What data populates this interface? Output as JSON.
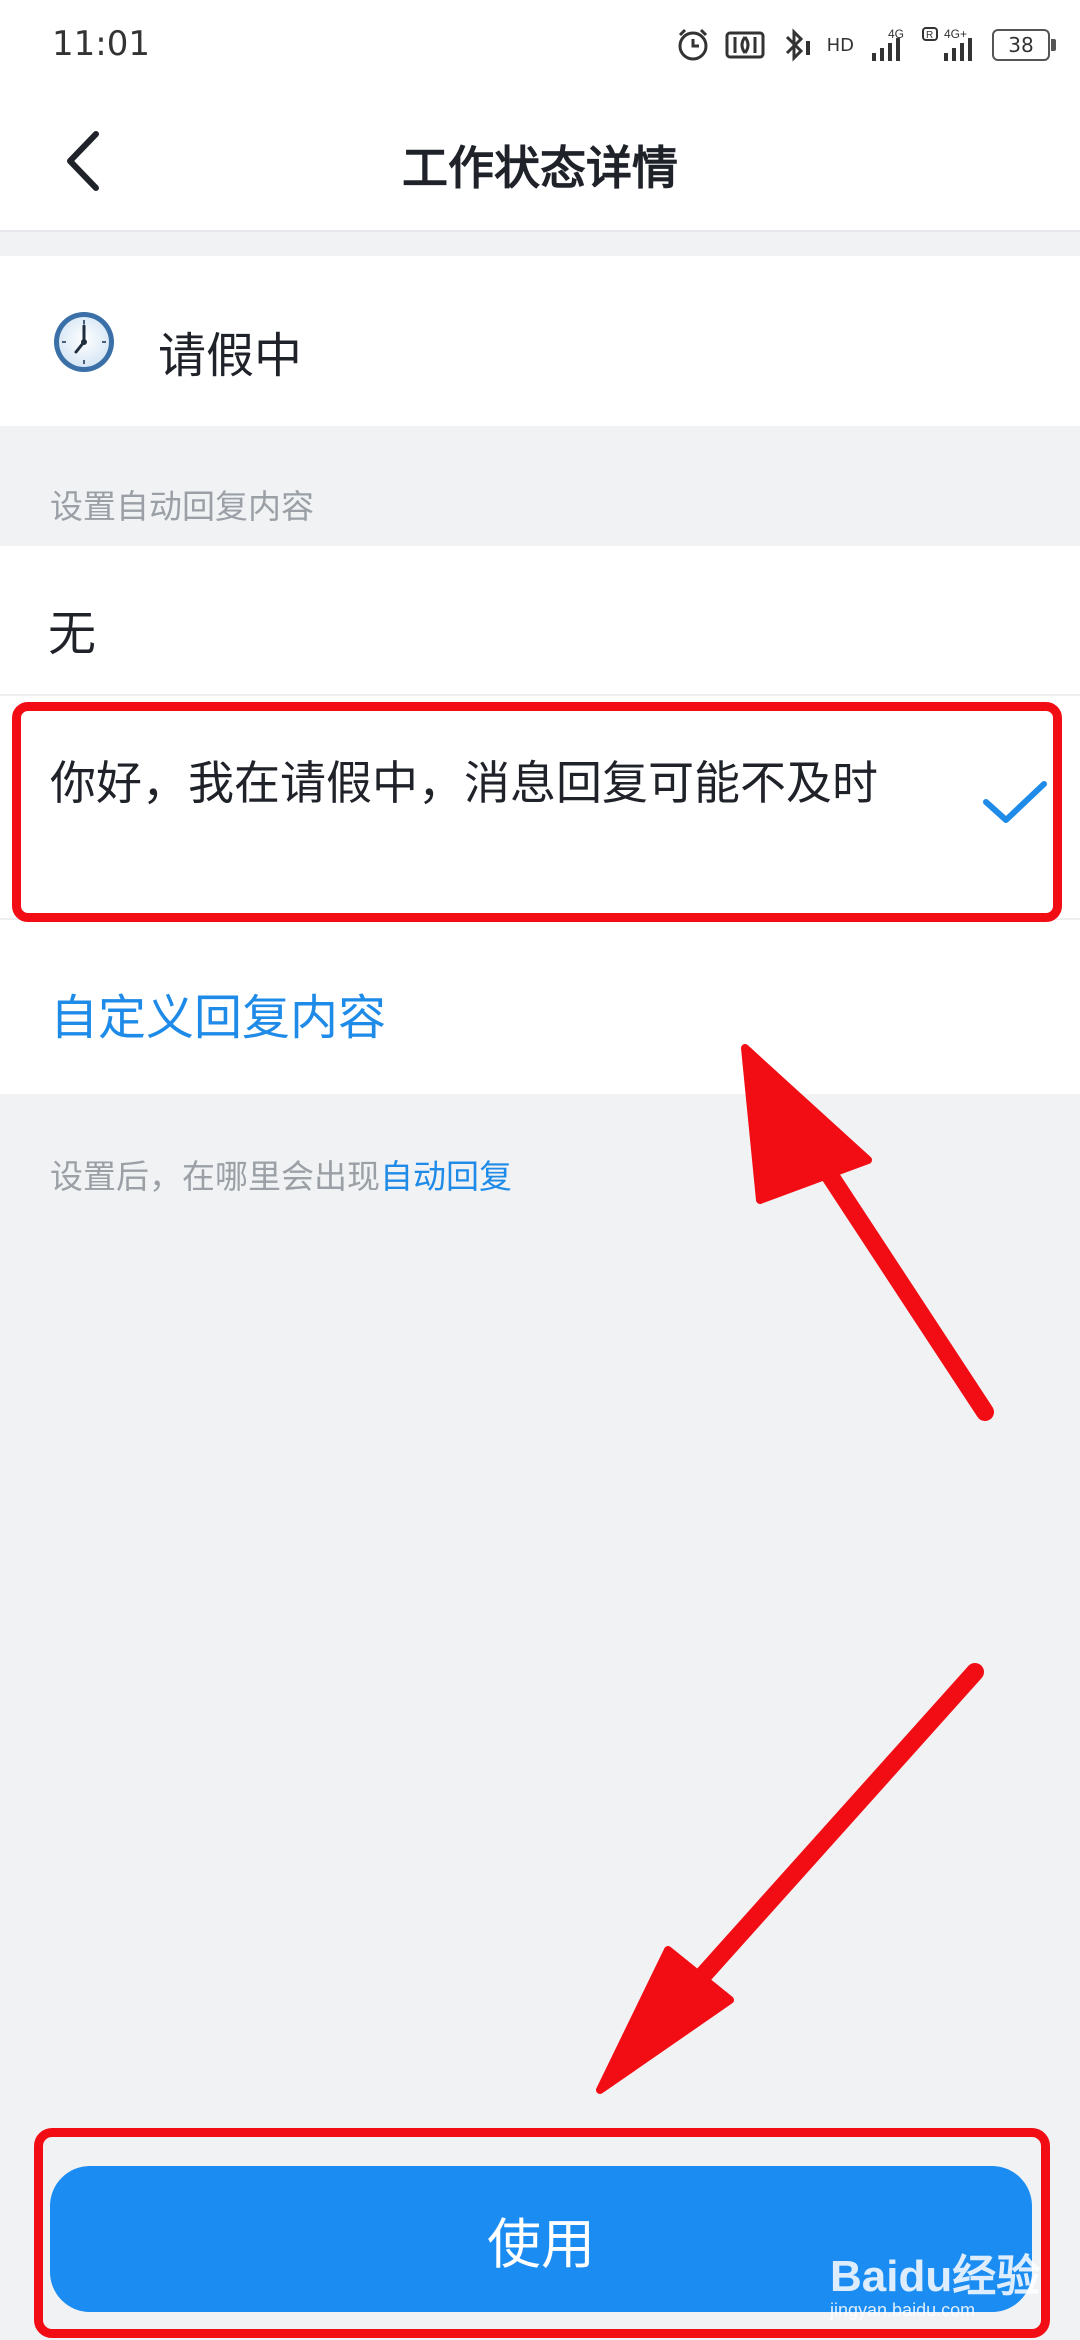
{
  "status_bar": {
    "time": "11:01",
    "network1": "HD",
    "network1_gen": "4G",
    "network2_gen": "4G+",
    "roaming": "R",
    "battery": "38",
    "icons": [
      "alarm-icon",
      "nfc-icon",
      "bluetooth-icon",
      "signal-icon",
      "signal-icon",
      "battery-icon"
    ]
  },
  "header": {
    "title": "工作状态详情",
    "back_icon": "chevron-left-icon"
  },
  "status": {
    "icon": "clock-icon",
    "label": "请假中"
  },
  "auto_reply": {
    "section_label": "设置自动回复内容",
    "options": [
      {
        "label": "无",
        "selected": false
      },
      {
        "label": "你好，我在请假中，消息回复可能不及时",
        "selected": true
      }
    ],
    "custom_label": "自定义回复内容",
    "accent_color": "#1e8be8"
  },
  "footnote": {
    "text": "设置后，在哪里会出现",
    "link": "自动回复"
  },
  "action": {
    "use_label": "使用",
    "color": "#1a8cf2"
  },
  "watermark": {
    "brand": "Baidu经验",
    "domain": "jingyan.baidu.com"
  },
  "annotation_color": "#f20d14"
}
